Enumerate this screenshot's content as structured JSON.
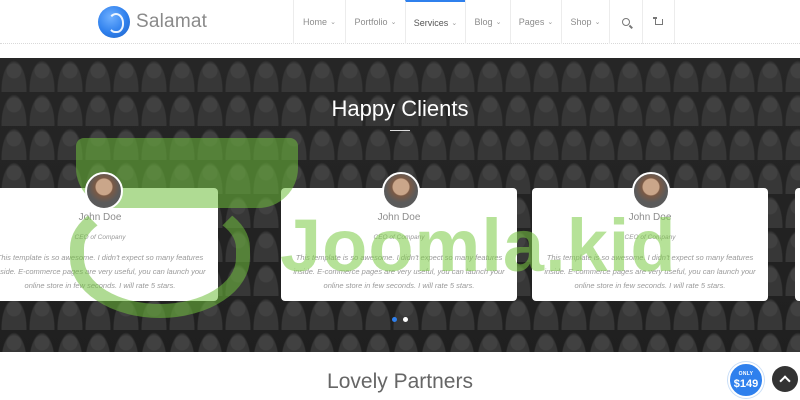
{
  "brand": {
    "name": "Salamat"
  },
  "nav": {
    "items": [
      {
        "label": "Home",
        "chevron": "⌄"
      },
      {
        "label": "Portfolio",
        "chevron": "⌄"
      },
      {
        "label": "Services",
        "chevron": "⌄"
      },
      {
        "label": "Blog",
        "chevron": "⌄"
      },
      {
        "label": "Pages",
        "chevron": "⌄"
      },
      {
        "label": "Shop",
        "chevron": "⌄"
      }
    ],
    "active": "Services",
    "icons": [
      "search-icon",
      "cart-icon"
    ]
  },
  "testimonials": {
    "title": "Happy Clients",
    "cards": [
      {
        "name": "John Doe",
        "role": "CEO of Company",
        "text": "This template is so awesome. I didn't expect so many features inside. E-commerce pages are very useful, you can launch your online store in few seconds. I will rate 5 stars."
      },
      {
        "name": "John Doe",
        "role": "CEO of Company",
        "text": "This template is so awesome. I didn't expect so many features inside. E-commerce pages are very useful, you can launch your online store in few seconds. I will rate 5 stars."
      },
      {
        "name": "John Doe",
        "role": "CEO of Company",
        "text": "This template is so awesome. I didn't expect so many features inside. E-commerce pages are very useful, you can launch your online store in few seconds. I will rate 5 stars."
      }
    ],
    "pagination": {
      "count": 2,
      "active_index": 0
    }
  },
  "watermark": {
    "text": "Joomla.kid"
  },
  "partners": {
    "title": "Lovely Partners"
  },
  "promo": {
    "label": "ONLY",
    "price": "$149"
  },
  "colors": {
    "accent": "#2f80ed",
    "band": "#2d2d2d",
    "watermark": "#7ccb45"
  }
}
